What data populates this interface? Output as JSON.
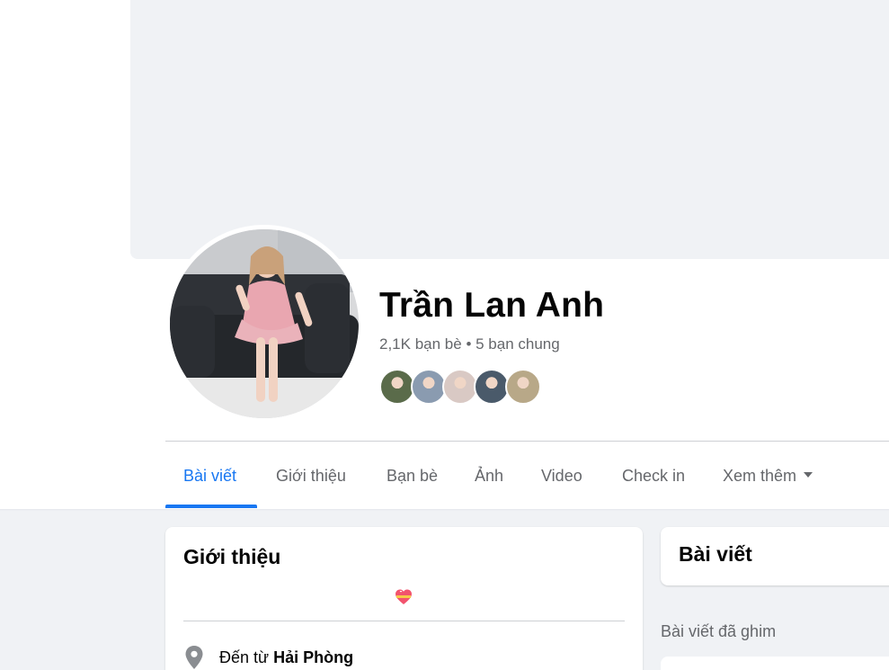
{
  "profile": {
    "name": "Trần Lan Anh",
    "friends_count": "2,1K bạn bè",
    "separator": "•",
    "mutual_friends": "5 bạn chung"
  },
  "mutual_avatars": [
    {
      "name": "mutual-friend-1",
      "color": "#5a6b4a"
    },
    {
      "name": "mutual-friend-2",
      "color": "#8a9bb0"
    },
    {
      "name": "mutual-friend-3",
      "color": "#d9c9c4"
    },
    {
      "name": "mutual-friend-4",
      "color": "#4a5a6a"
    },
    {
      "name": "mutual-friend-5",
      "color": "#b8a888"
    }
  ],
  "tabs": [
    {
      "label": "Bài viết",
      "active": true
    },
    {
      "label": "Giới thiệu",
      "active": false
    },
    {
      "label": "Bạn bè",
      "active": false
    },
    {
      "label": "Ảnh",
      "active": false
    },
    {
      "label": "Video",
      "active": false
    },
    {
      "label": "Check in",
      "active": false
    },
    {
      "label": "Xem thêm",
      "active": false
    }
  ],
  "intro": {
    "title": "Giới thiệu",
    "bio_icon": "heart-emoji-icon",
    "from_prefix": "Đến từ",
    "from_place": "Hải Phòng"
  },
  "posts": {
    "title": "Bài viết",
    "pinned_label": "Bài viết đã ghim"
  },
  "colors": {
    "accent": "#1877f2",
    "secondary_text": "#65676b",
    "background": "#f0f2f5"
  }
}
